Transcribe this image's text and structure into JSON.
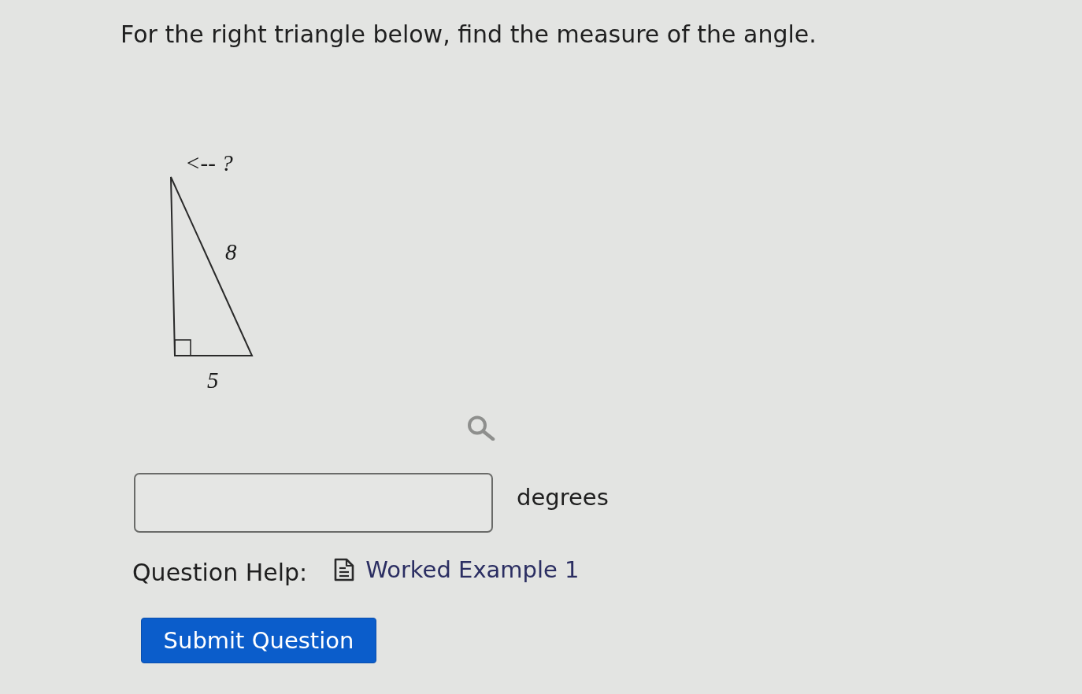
{
  "question": {
    "prompt": "For the right triangle below, find the measure of the angle."
  },
  "figure": {
    "angle_label": "<-- ?",
    "hypotenuse_label": "8",
    "base_label": "5"
  },
  "answer": {
    "unit": "degrees"
  },
  "help": {
    "label": "Question Help:",
    "links": [
      {
        "label": "Worked Example 1"
      }
    ]
  },
  "submit": {
    "label": "Submit Question"
  }
}
